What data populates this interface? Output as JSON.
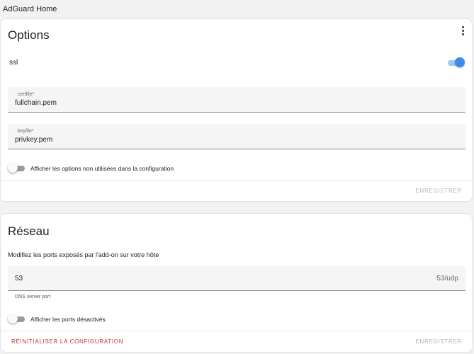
{
  "app": {
    "title": "AdGuard Home"
  },
  "options_card": {
    "title": "Options",
    "ssl_label": "ssl",
    "ssl_enabled": true,
    "certfile": {
      "label": "certfile*",
      "value": "fullchain.pem"
    },
    "keyfile": {
      "label": "keyfile*",
      "value": "privkey.pem"
    },
    "show_unused_label": "Afficher les options non utilisées dans la configuration",
    "show_unused_enabled": false,
    "save_label": "ENREGISTRER"
  },
  "network_card": {
    "title": "Réseau",
    "description": "Modifiez les ports exposés par l'add-on sur votre hôte",
    "port_field": {
      "value": "53",
      "suffix": "53/udp",
      "helper": "DNS server port"
    },
    "show_disabled_label": "Afficher les ports désactivés",
    "show_disabled_enabled": false,
    "reset_label": "RÉINITIALISER LA CONFIGURATION",
    "save_label": "ENREGISTRER"
  },
  "colors": {
    "accent": "#3d8be8",
    "danger": "#c0392b",
    "disabled": "#b5b5b5"
  }
}
